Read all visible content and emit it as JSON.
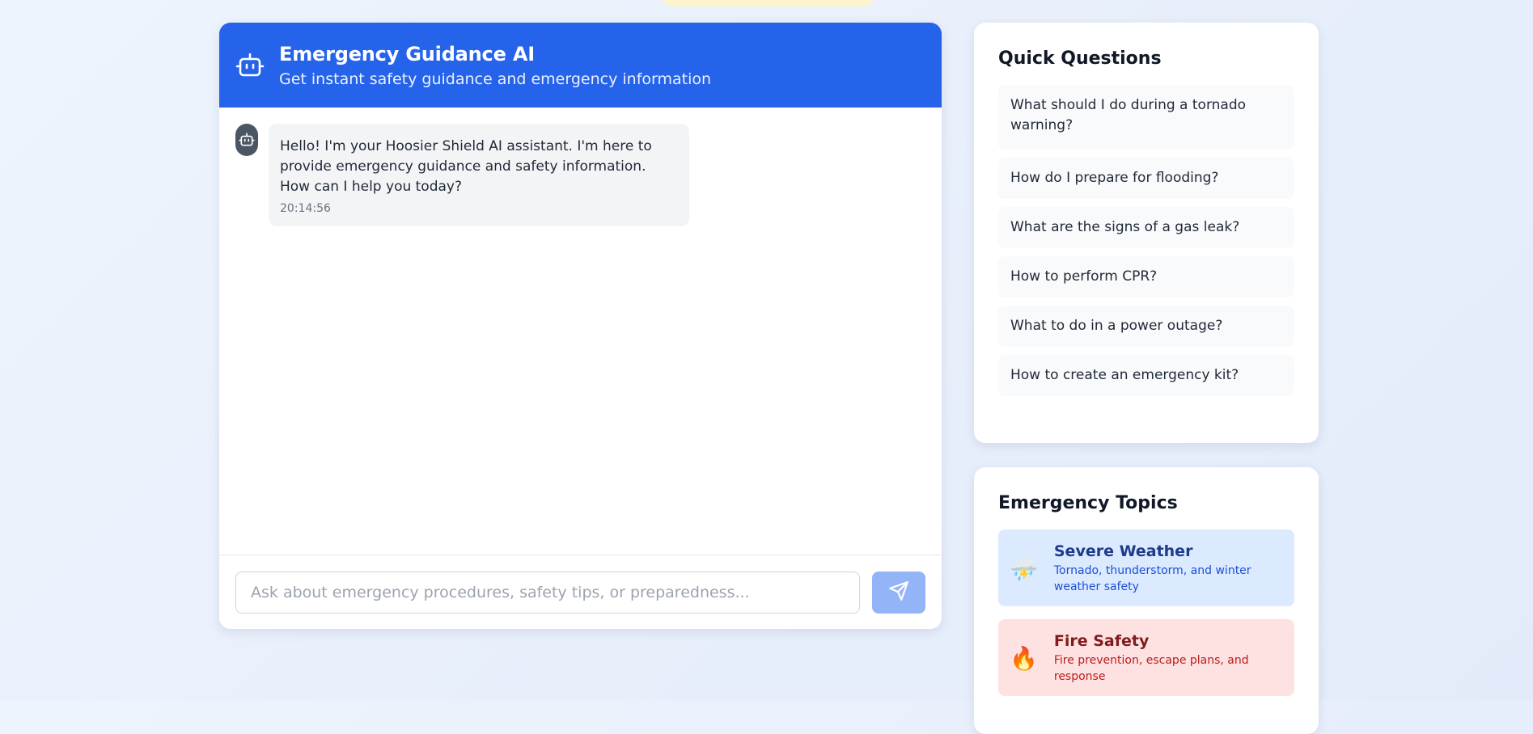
{
  "chat": {
    "title": "Emergency Guidance AI",
    "subtitle": "Get instant safety guidance and emergency information",
    "header_icon": "robot-icon",
    "messages": [
      {
        "sender": "bot",
        "avatar_icon": "robot-icon",
        "text": "Hello! I'm your Hoosier Shield AI assistant. I'm here to provide emergency guidance and safety information. How can I help you today?",
        "time": "20:14:56"
      }
    ],
    "input": {
      "value": "",
      "placeholder": "Ask about emergency procedures, safety tips, or preparedness..."
    },
    "send_icon": "send-icon"
  },
  "quick_questions": {
    "title": "Quick Questions",
    "items": [
      "What should I do during a tornado warning?",
      "How do I prepare for flooding?",
      "What are the signs of a gas leak?",
      "How to perform CPR?",
      "What to do in a power outage?",
      "How to create an emergency kit?"
    ]
  },
  "emergency_topics": {
    "title": "Emergency Topics",
    "items": [
      {
        "icon": "storm-cloud-icon",
        "emoji": "⛈️",
        "title": "Severe Weather",
        "description": "Tornado, thunderstorm, and winter weather safety",
        "bg": "#dbeafe",
        "title_color": "#1e3a8a",
        "desc_color": "#1d4ed8"
      },
      {
        "icon": "fire-icon",
        "emoji": "🔥",
        "title": "Fire Safety",
        "description": "Fire prevention, escape plans, and response",
        "bg": "#fee2e2",
        "title_color": "#7f1d1d",
        "desc_color": "#b91c1c"
      }
    ]
  },
  "colors": {
    "primary": "#2563eb",
    "send_button": "#93b4f6",
    "bubble": "#f3f4f6",
    "banner": "#fdf5c9"
  }
}
